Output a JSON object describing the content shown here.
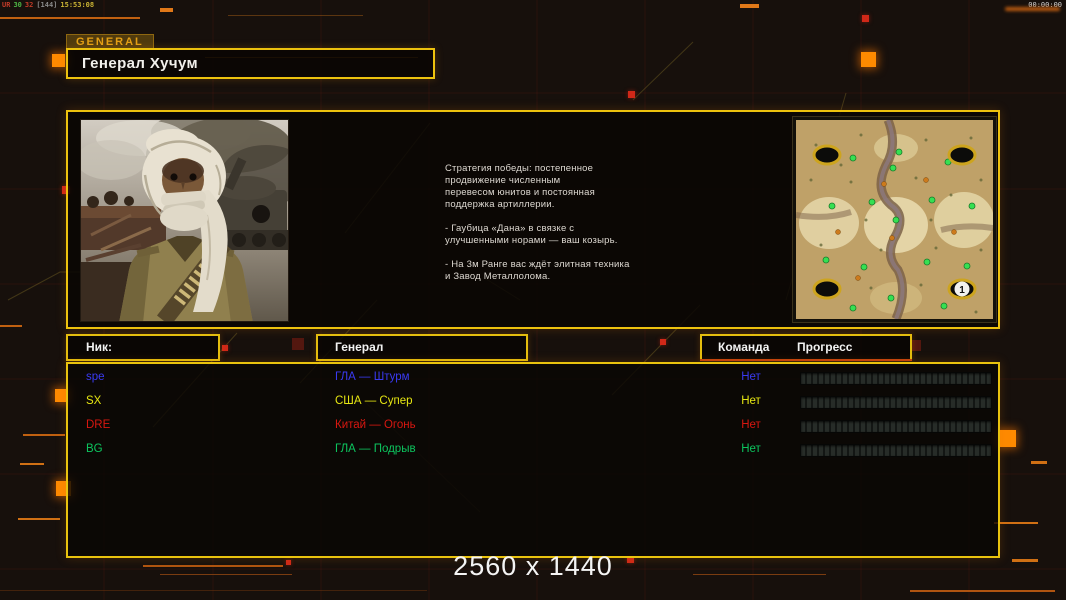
{
  "hud": {
    "debug": [
      {
        "text": "UR",
        "color": "#c23b28"
      },
      {
        "text": "30",
        "color": "#4db344"
      },
      {
        "text": "32",
        "color": "#c23b28"
      },
      {
        "text": "[144]",
        "color": "#8a8a8a"
      },
      {
        "text": "15:53:08",
        "color": "#c9b233"
      }
    ],
    "clock": "00:00:00"
  },
  "header": {
    "tab_label": "GENERAL",
    "title": "Генерал Хучум"
  },
  "briefing": {
    "paragraphs": [
      "Стратегия победы: постепенное\nпродвижение численным\nперевесом юнитов и постоянная\nподдержка артиллерии.",
      "- Гаубица «Дана» в связке с\nулучшенными норами — ваш козырь.",
      "- На 3м Ранге вас ждёт элитная техника\nи Завод Металлолома."
    ]
  },
  "map": {
    "start_marker_label": "1"
  },
  "table": {
    "headers": {
      "nick": "Ник:",
      "general": "Генерал",
      "team": "Команда",
      "progress": "Прогресс"
    },
    "players": [
      {
        "name": "spe",
        "general": "ГЛА — Штурм",
        "team": "Нет",
        "progress": 0,
        "color": "#3a3af2"
      },
      {
        "name": "SX",
        "general": "США — Супер",
        "team": "Нет",
        "progress": 0,
        "color": "#e6e612"
      },
      {
        "name": "DRE",
        "general": "Китай — Огонь",
        "team": "Нет",
        "progress": 0,
        "color": "#d81710"
      },
      {
        "name": "BG",
        "general": "ГЛА — Подрыв",
        "team": "Нет",
        "progress": 0,
        "color": "#0cc55e"
      }
    ]
  },
  "footer": {
    "resolution": "2560 x 1440"
  },
  "colors": {
    "accent_yellow": "#edc20e",
    "accent_orange": "#e07818",
    "alert_red": "#d02818"
  }
}
